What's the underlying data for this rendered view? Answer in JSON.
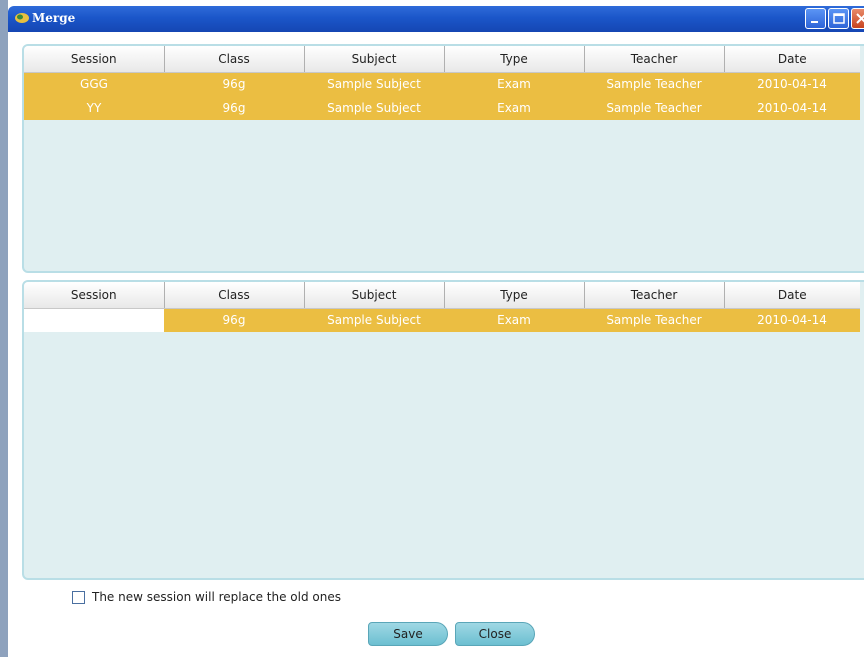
{
  "window": {
    "title": "Merge"
  },
  "columns": [
    "Session",
    "Class",
    "Subject",
    "Type",
    "Teacher",
    "Date"
  ],
  "top_rows": [
    [
      "GGG",
      "96g",
      "Sample Subject",
      "Exam",
      "Sample Teacher",
      "2010-04-14"
    ],
    [
      "YY",
      "96g",
      "Sample Subject",
      "Exam",
      "Sample Teacher",
      "2010-04-14"
    ]
  ],
  "bottom_rows": [
    [
      "",
      "96g",
      "Sample Subject",
      "Exam",
      "Sample Teacher",
      "2010-04-14"
    ]
  ],
  "footer": {
    "replace_label": "The new session will replace the old ones",
    "replace_checked": false,
    "save_label": "Save",
    "close_label": "Close"
  },
  "colors": {
    "selected_row": "#ebbe42",
    "panel": "#e0eff1",
    "titlebar": "#1b56c9"
  }
}
